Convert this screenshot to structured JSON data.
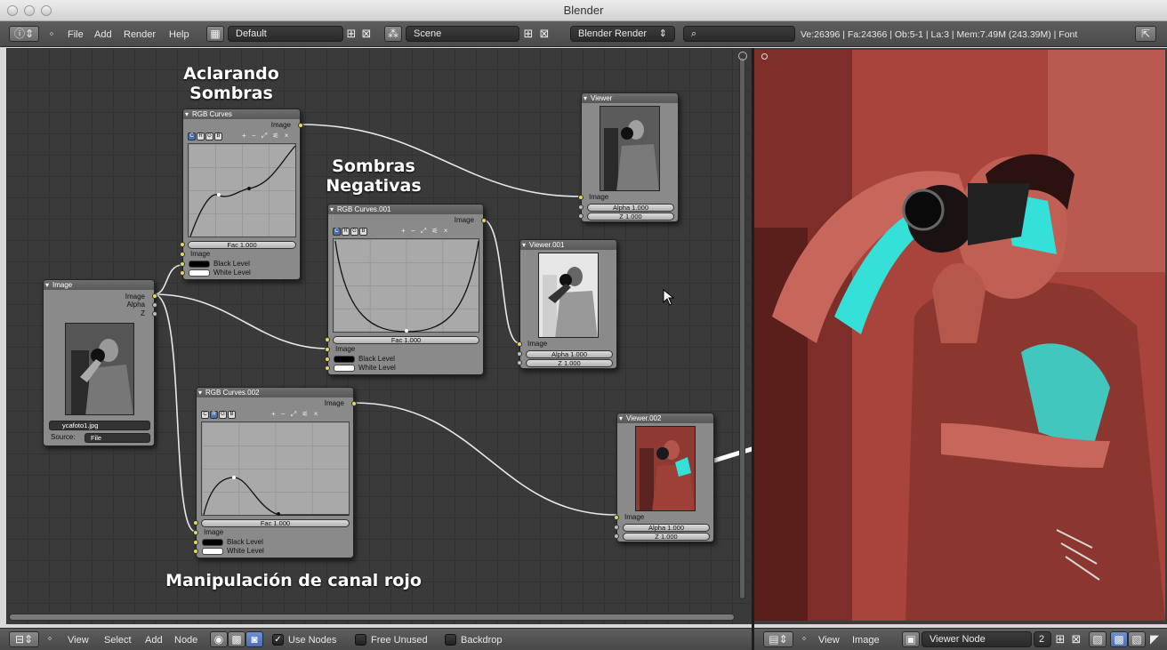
{
  "window": {
    "title": "Blender"
  },
  "info_header": {
    "menus": [
      "File",
      "Add",
      "Render",
      "Help"
    ],
    "layout": "Default",
    "scene": "Scene",
    "render_engine": "Blender Render",
    "stats": "Ve:26396 | Fa:24366 | Ob:5-1 | La:3 | Mem:7.49M (243.39M) | Font"
  },
  "annotations": {
    "aclarando": "Aclarando\nSombras",
    "negativas": "Sombras\nNegativas",
    "rojo": "Manipulación de canal rojo"
  },
  "nodes": {
    "image": {
      "title": "Image",
      "out_image": "Image",
      "out_alpha": "Alpha",
      "out_z": "Z",
      "file": "ycafoto1.jpg",
      "source_label": "Source:",
      "source": "File"
    },
    "curves1": {
      "title": "RGB Curves",
      "out": "Image",
      "fac": "Fac 1.000",
      "in_image": "Image",
      "black": "Black Level",
      "white": "White Level",
      "channels": [
        "C",
        "R",
        "G",
        "B"
      ]
    },
    "curves2": {
      "title": "RGB Curves.001",
      "out": "Image",
      "fac": "Fac 1.000",
      "in_image": "Image",
      "black": "Black Level",
      "white": "White Level",
      "channels": [
        "C",
        "R",
        "G",
        "B"
      ]
    },
    "curves3": {
      "title": "RGB Curves.002",
      "out": "Image",
      "fac": "Fac 1.000",
      "in_image": "Image",
      "black": "Black Level",
      "white": "White Level",
      "channels": [
        "C",
        "R",
        "G",
        "B"
      ]
    },
    "viewer": {
      "title": "Viewer",
      "image": "Image",
      "alpha": "Alpha 1.000",
      "z": "Z 1.000"
    },
    "viewer1": {
      "title": "Viewer.001",
      "image": "Image",
      "alpha": "Alpha 1.000",
      "z": "Z 1.000"
    },
    "viewer2": {
      "title": "Viewer.002",
      "image": "Image",
      "alpha": "Alpha 1.000",
      "z": "Z 1.000"
    }
  },
  "node_header": {
    "menus": [
      "View",
      "Select",
      "Add",
      "Node"
    ],
    "use_nodes": "Use Nodes",
    "free_unused": "Free Unused",
    "backdrop": "Backdrop"
  },
  "image_header": {
    "menus": [
      "View",
      "Image"
    ],
    "image_name": "Viewer Node",
    "users": "2"
  },
  "colors": {
    "socket": "#e6d85a",
    "photo_red": "#a8443c",
    "photo_cyan": "#35e0d8"
  }
}
